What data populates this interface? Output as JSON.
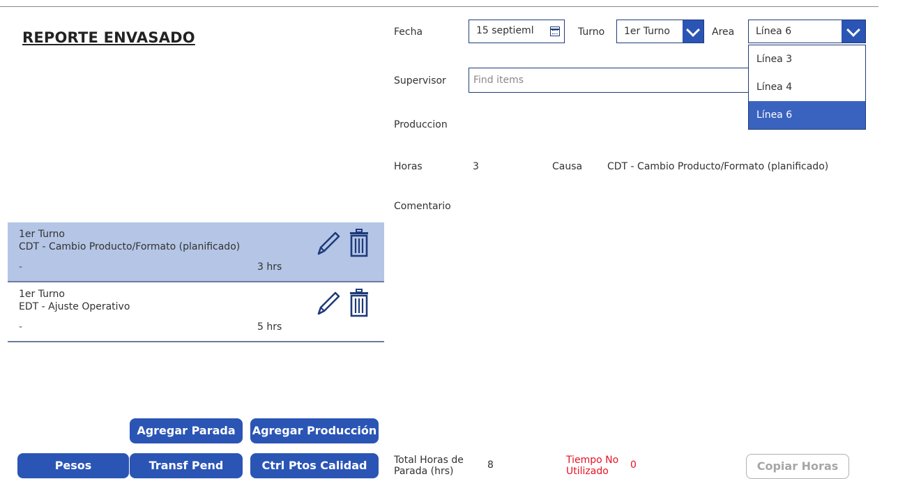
{
  "page": {
    "title": "REPORTE ENVASADO"
  },
  "form": {
    "fecha_label": "Fecha",
    "fecha_value": "15 septieml",
    "turno_label": "Turno",
    "turno_value": "1er Turno",
    "area_label": "Area",
    "area_value": "Línea 6",
    "area_options": [
      "Línea 3",
      "Línea 4",
      "Línea 6"
    ],
    "area_selected_index": 2,
    "supervisor_label": "Supervisor",
    "supervisor_placeholder": "Find items",
    "produccion_label": "Produccion",
    "horas_label": "Horas",
    "horas_value": "3",
    "causa_label": "Causa",
    "causa_value": "CDT - Cambio Producto/Formato (planificado)",
    "comentario_label": "Comentario"
  },
  "list": {
    "items": [
      {
        "turno": "1er Turno",
        "causa": "CDT - Cambio Producto/Formato (planificado)",
        "comentario": "-",
        "horas": "3 hrs",
        "selected": true
      },
      {
        "turno": "1er Turno",
        "causa": "EDT - Ajuste Operativo",
        "comentario": "-",
        "horas": "5 hrs",
        "selected": false
      }
    ]
  },
  "buttons": {
    "agregar_parada": "Agregar Parada",
    "agregar_produccion": "Agregar Producción",
    "pesos": "Pesos",
    "transf_pend": "Transf Pend",
    "ctrl_ptos_calidad": "Ctrl Ptos Calidad",
    "copiar_horas": "Copiar Horas"
  },
  "footer": {
    "total_horas_label_1": "Total Horas de",
    "total_horas_label_2": "Parada (hrs)",
    "total_horas_value": "8",
    "tiempo_label_1": "Tiempo No",
    "tiempo_label_2": "Utilizado",
    "tiempo_value": "0"
  },
  "colors": {
    "primary": "#2b55b5",
    "selected_row": "#b4c5e6",
    "selected_option": "#3a63c0",
    "warning": "#e81123",
    "icon": "#1f3a7a"
  },
  "icons": [
    "calendar-icon",
    "chevron-down-icon",
    "pencil-icon",
    "trash-icon"
  ]
}
